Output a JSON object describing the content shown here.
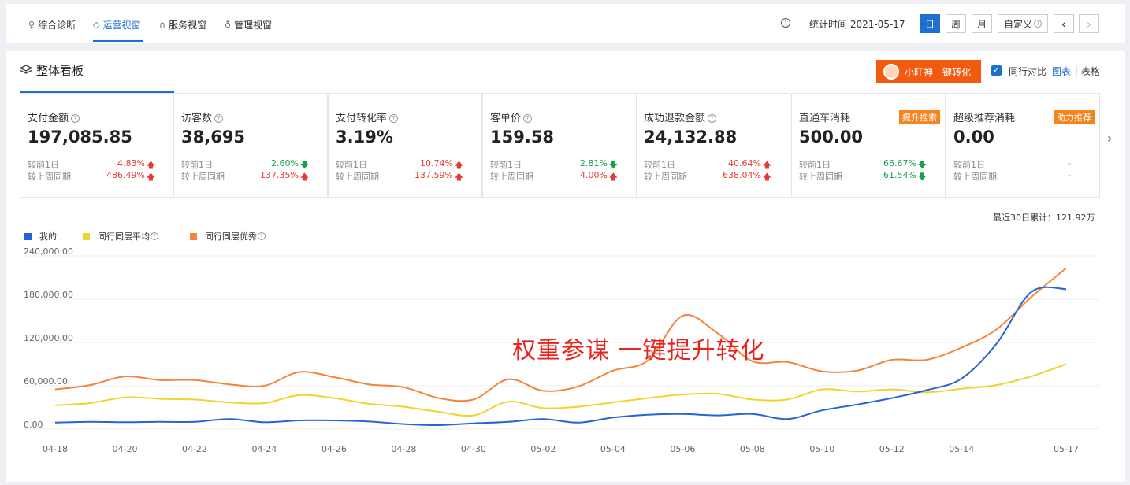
{
  "nav": {
    "tabs": [
      {
        "icon": "diagnosis-icon",
        "label": "综合诊断"
      },
      {
        "icon": "shield-icon",
        "label": "运营视窗"
      },
      {
        "icon": "headset-icon",
        "label": "服务视窗"
      },
      {
        "icon": "medal-icon",
        "label": "管理视窗"
      }
    ],
    "stat_time_label": "统计时间 2021-05-17",
    "periods": [
      "日",
      "周",
      "月",
      "自定义"
    ],
    "active_period": "日",
    "prev_label": "‹",
    "next_label": "›"
  },
  "panel": {
    "title": "整体看板",
    "promo_button": "小旺神一键转化",
    "compare_label": "同行对比",
    "view_chart": "图表",
    "view_table": "表格"
  },
  "metrics": [
    {
      "title": "支付金额",
      "value": "197,085.85",
      "day_label": "较前1日",
      "day_pct": "4.83%",
      "day_dir": "up",
      "week_label": "较上周同期",
      "week_pct": "486.49%",
      "week_dir": "up"
    },
    {
      "title": "访客数",
      "value": "38,695",
      "day_label": "较前1日",
      "day_pct": "2.60%",
      "day_dir": "down",
      "week_label": "较上周同期",
      "week_pct": "137.35%",
      "week_dir": "up"
    },
    {
      "title": "支付转化率",
      "value": "3.19%",
      "day_label": "较前1日",
      "day_pct": "10.74%",
      "day_dir": "up",
      "week_label": "较上周同期",
      "week_pct": "137.59%",
      "week_dir": "up"
    },
    {
      "title": "客单价",
      "value": "159.58",
      "day_label": "较前1日",
      "day_pct": "2.81%",
      "day_dir": "down",
      "week_label": "较上周同期",
      "week_pct": "4.00%",
      "week_dir": "up"
    },
    {
      "title": "成功退款金额",
      "value": "24,132.88",
      "day_label": "较前1日",
      "day_pct": "40.64%",
      "day_dir": "up",
      "week_label": "较上周同期",
      "week_pct": "638.04%",
      "week_dir": "up"
    },
    {
      "title": "直通车消耗",
      "value": "500.00",
      "badge": "提升搜索",
      "day_label": "较前1日",
      "day_pct": "66.67%",
      "day_dir": "down",
      "week_label": "较上周同期",
      "week_pct": "61.54%",
      "week_dir": "down"
    },
    {
      "title": "超级推荐消耗",
      "value": "0.00",
      "badge": "助力推荐",
      "day_label": "较前1日",
      "day_pct": "-",
      "day_dir": "none",
      "week_label": "较上周同期",
      "week_pct": "-",
      "week_dir": "none"
    }
  ],
  "total_label": "最近30日累计：121.92万",
  "overlay_text": "权重参谋  一键提升转化",
  "colors": {
    "mine": "#2563d6",
    "avg": "#f2d22e",
    "excellent": "#f5843a",
    "accent": "#1f6fd0",
    "up": "#e53935",
    "down": "#17a34a"
  },
  "chart_data": {
    "type": "line",
    "x": [
      "04-18",
      "04-19",
      "04-20",
      "04-21",
      "04-22",
      "04-23",
      "04-24",
      "04-25",
      "04-26",
      "04-27",
      "04-28",
      "04-29",
      "04-30",
      "05-01",
      "05-02",
      "05-03",
      "05-04",
      "05-05",
      "05-06",
      "05-07",
      "05-08",
      "05-09",
      "05-10",
      "05-11",
      "05-12",
      "05-13",
      "05-14",
      "05-15",
      "05-16",
      "05-17"
    ],
    "xticks": [
      "04-18",
      "04-20",
      "04-22",
      "04-24",
      "04-26",
      "04-28",
      "04-30",
      "05-02",
      "05-04",
      "05-06",
      "05-08",
      "05-10",
      "05-12",
      "05-14",
      "05-17"
    ],
    "yticks": [
      "240,000.00",
      "180,000.00",
      "120,000.00",
      "60,000.00",
      "0.00"
    ],
    "ylim": [
      0,
      240000
    ],
    "series": [
      {
        "name": "我的",
        "color": "#2563d6",
        "values": [
          9000,
          10000,
          9500,
          10000,
          10000,
          14000,
          9500,
          12000,
          12000,
          10500,
          7000,
          5500,
          8000,
          10000,
          14000,
          9000,
          16000,
          20000,
          21000,
          19000,
          21000,
          14000,
          26000,
          34000,
          43000,
          54000,
          70000,
          118000,
          190000,
          194000
        ]
      },
      {
        "name": "同行同层平均",
        "color": "#f2d22e",
        "values": [
          33000,
          36000,
          44000,
          42000,
          41000,
          37000,
          36000,
          47000,
          43000,
          35000,
          31000,
          24000,
          19000,
          38000,
          29000,
          31000,
          37000,
          43000,
          48000,
          49000,
          41000,
          41000,
          55000,
          52000,
          55000,
          51000,
          56000,
          61000,
          73000,
          90000
        ]
      },
      {
        "name": "同行同层优秀",
        "color": "#f5843a",
        "values": [
          55000,
          61000,
          73000,
          68000,
          68000,
          62000,
          60000,
          79000,
          72000,
          62000,
          58000,
          43000,
          41000,
          69000,
          53000,
          59000,
          81000,
          95000,
          157000,
          133000,
          94000,
          93000,
          80000,
          81000,
          96000,
          96000,
          113000,
          138000,
          183000,
          223000
        ]
      }
    ]
  }
}
